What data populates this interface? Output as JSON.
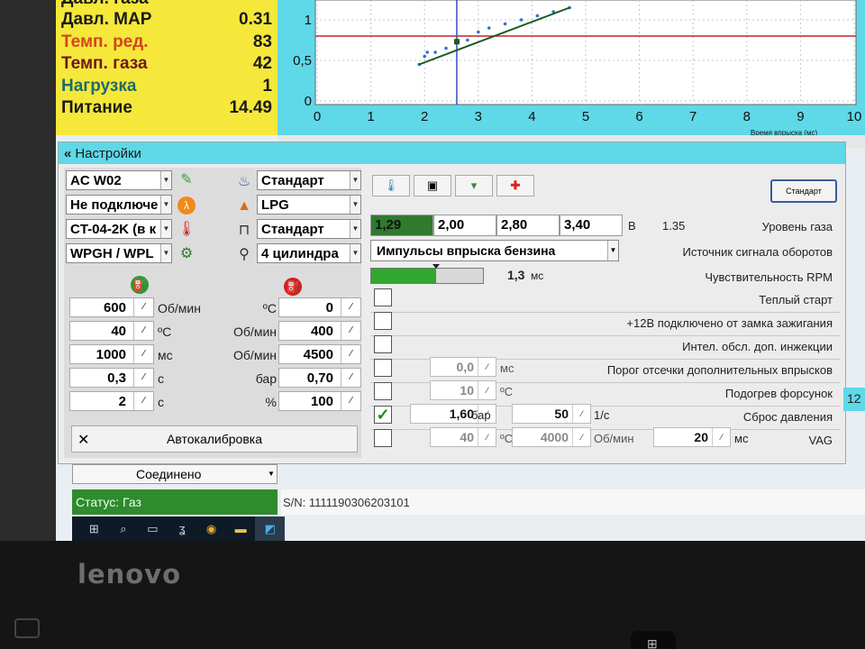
{
  "readings": [
    {
      "label": "Давл. газа",
      "value": ""
    },
    {
      "label": "Давл. MAP",
      "value": "0.31",
      "color": "#1a1a1a"
    },
    {
      "label": "Темп. ред.",
      "value": "83",
      "color": "#d2451e"
    },
    {
      "label": "Темп. газа",
      "value": "42",
      "color": "#6b1a1a"
    },
    {
      "label": "Нагрузка",
      "value": "1",
      "color": "#1d6b6b"
    },
    {
      "label": "Питание",
      "value": "14.49",
      "color": "#1a1a1a"
    }
  ],
  "chart_data": {
    "type": "scatter",
    "xlabel": "Время впрыска (мс)",
    "ylabel": "",
    "xlim": [
      0,
      10
    ],
    "ylim": [
      0,
      1.2
    ],
    "x_ticks": [
      "0",
      "1",
      "2",
      "3",
      "4",
      "5",
      "6",
      "7",
      "8",
      "9",
      "10"
    ],
    "y_ticks": [
      "0",
      "0,5",
      "1"
    ],
    "series": [
      {
        "x": [
          1.9,
          2.0,
          2.05,
          2.2,
          2.4,
          2.6,
          2.8,
          3.0,
          3.2,
          3.5,
          3.8,
          4.1,
          4.4,
          4.7
        ],
        "y": [
          0.45,
          0.55,
          0.6,
          0.6,
          0.65,
          0.75,
          0.75,
          0.85,
          0.9,
          0.95,
          1.0,
          1.05,
          1.1,
          1.15
        ]
      }
    ],
    "reference_line_y": 0.8,
    "cursor_x": 2.6,
    "colors": {
      "trend": "#1a5a1a",
      "reference": "#c8242a",
      "cursor": "#3050c0",
      "points": "#3070d0"
    }
  },
  "settings": {
    "title": "Настройки",
    "controller_dd": "AC W02",
    "connect_dd": "Не подключе",
    "injector_dd": "CT-04-2K (в к",
    "reducer_dd": "WPGH / WPL",
    "mode_dd": "Стандарт",
    "fuel_dd": "LPG",
    "ignition_dd": "Стандарт",
    "cyl_dd": "4 цилиндра",
    "left_values": [
      {
        "value": "600",
        "unit": "Об/мин"
      },
      {
        "value": "40",
        "unit": "ºC"
      },
      {
        "value": "1000",
        "unit": "мс"
      },
      {
        "value": "0,3",
        "unit": "с"
      },
      {
        "value": "2",
        "unit": "с"
      }
    ],
    "right_values": [
      {
        "unit": "ºC",
        "value": "0"
      },
      {
        "unit": "Об/мин",
        "value": "400"
      },
      {
        "unit": "Об/мин",
        "value": "4500"
      },
      {
        "unit": "бар",
        "value": "0,70"
      },
      {
        "unit": "%",
        "value": "100"
      }
    ],
    "autocal_label": "Автокалибровка",
    "standart_button": "Стандарт",
    "gas_levels": [
      "1,29",
      "2,00",
      "2,80",
      "3,40"
    ],
    "gas_unit": "В",
    "gas_current": "1.35",
    "gas_level_label": "Уровень газа",
    "rpm_source_dd": "Импульсы впрыска бензина",
    "rpm_source_label": "Источник сигнала оборотов",
    "rpm_sens_value": "1,3",
    "rpm_sens_unit": "мс",
    "rpm_sens_fill": 0.58,
    "rpm_sens_label": "Чувствительность RPM",
    "warm_start": "Теплый старт",
    "ign_label": "+12В подключено от замка зажигания",
    "intel_label": "Интел. обсл. доп. инжекции",
    "extra_value": "0,0",
    "extra_unit": "мс",
    "extra_label": "Порог отсечки дополнительных впрысков",
    "heat_value": "10",
    "heat_unit": "ºC",
    "heat_label": "Подогрев форсунок",
    "reset_value": "1,60",
    "reset_unit": "бар",
    "reset_rate": "50",
    "reset_rate_unit": "1/с",
    "reset_label": "Сброс давления",
    "vag_temp": "40",
    "vag_temp_unit": "ºC",
    "vag_rpm": "4000",
    "vag_rpm_unit": "Об/мин",
    "vag_time": "20",
    "vag_time_unit": "мс",
    "vag_label": "VAG"
  },
  "connection_dd": "Соединено",
  "status": "Статус: Газ",
  "serial": "S/N: 1111190306203101",
  "right_edge_value": "12",
  "brand": "lenovo"
}
